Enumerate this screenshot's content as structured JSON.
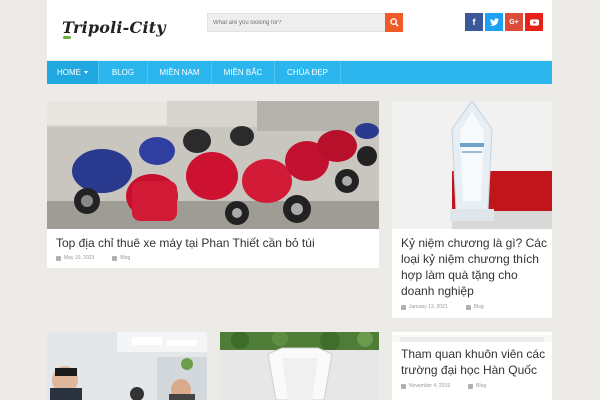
{
  "header": {
    "logo_text": "Tripoli-City",
    "search_placeholder": "What are you looking for?",
    "social": [
      {
        "name": "facebook",
        "glyph": "f",
        "color": "#3b5998"
      },
      {
        "name": "twitter",
        "glyph": "t",
        "color": "#1da1f2"
      },
      {
        "name": "google-plus",
        "glyph": "G+",
        "color": "#dd4b39"
      },
      {
        "name": "youtube",
        "glyph": "▶",
        "color": "#e62117"
      }
    ]
  },
  "nav": {
    "items": [
      "HOME",
      "BLOG",
      "MIỀN NAM",
      "MIỀN BẮC",
      "CHÙA ĐẸP"
    ]
  },
  "posts": [
    {
      "title": "Top địa chỉ thuê xe máy tại Phan Thiết cần bỏ túi",
      "date": "May 10, 2023",
      "category": "Blog"
    },
    {
      "title": "Kỷ niệm chương là gì? Các loại kỷ niệm chương thích hợp làm quà tặng cho doanh nghiệp",
      "date": "January 13, 2021",
      "category": "Blog"
    },
    {
      "title": "Tham quan khuôn viên các trường đại học Hàn Quốc",
      "date": "November 4, 2019",
      "category": "Blog"
    }
  ],
  "colors": {
    "accent": "#2bb7ee",
    "search_button": "#f05a28"
  }
}
